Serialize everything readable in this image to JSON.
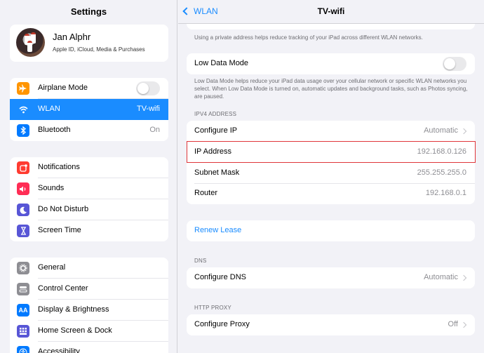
{
  "sidebar": {
    "title": "Settings",
    "profile": {
      "name": "Jan Alphr",
      "subtitle": "Apple ID, iCloud, Media & Purchases"
    },
    "group1": [
      {
        "label": "Airplane Mode",
        "icon": "airplane-icon",
        "color": "#ff9500",
        "toggle": "off"
      },
      {
        "label": "WLAN",
        "value": "TV-wifi",
        "icon": "wifi-icon",
        "color": "#1a8cff",
        "selected": true
      },
      {
        "label": "Bluetooth",
        "value": "On",
        "icon": "bluetooth-icon",
        "color": "#007aff"
      }
    ],
    "group2": [
      {
        "label": "Notifications",
        "icon": "notifications-icon",
        "color": "#ff3b30"
      },
      {
        "label": "Sounds",
        "icon": "sounds-icon",
        "color": "#ff2d55"
      },
      {
        "label": "Do Not Disturb",
        "icon": "moon-icon",
        "color": "#5856d6"
      },
      {
        "label": "Screen Time",
        "icon": "hourglass-icon",
        "color": "#5856d6"
      }
    ],
    "group3": [
      {
        "label": "General",
        "icon": "gear-icon",
        "color": "#8e8e93"
      },
      {
        "label": "Control Center",
        "icon": "control-center-icon",
        "color": "#8e8e93"
      },
      {
        "label": "Display & Brightness",
        "icon": "display-icon",
        "color": "#007aff"
      },
      {
        "label": "Home Screen & Dock",
        "icon": "home-screen-icon",
        "color": "#5856d6"
      },
      {
        "label": "Accessibility",
        "icon": "accessibility-icon",
        "color": "#007aff"
      }
    ]
  },
  "detail": {
    "back_label": "WLAN",
    "title": "TV-wifi",
    "private_note": "Using a private address helps reduce tracking of your iPad across different WLAN networks.",
    "low_data": {
      "label": "Low Data Mode",
      "toggle": "off"
    },
    "low_data_note": "Low Data Mode helps reduce your iPad data usage over your cellular network or specific WLAN networks you select. When Low Data Mode is turned on, automatic updates and background tasks, such as Photos syncing, are paused.",
    "ipv4_header": "IPV4 ADDRESS",
    "configure_ip": {
      "label": "Configure IP",
      "value": "Automatic"
    },
    "ip_address": {
      "label": "IP Address",
      "value": "192.168.0.126"
    },
    "subnet_mask": {
      "label": "Subnet Mask",
      "value": "255.255.255.0"
    },
    "router": {
      "label": "Router",
      "value": "192.168.0.1"
    },
    "renew_lease": "Renew Lease",
    "dns_header": "DNS",
    "configure_dns": {
      "label": "Configure DNS",
      "value": "Automatic"
    },
    "proxy_header": "HTTP PROXY",
    "configure_proxy": {
      "label": "Configure Proxy",
      "value": "Off"
    }
  },
  "colors": {
    "accent": "#1a8cff",
    "highlight": "#e0363a"
  }
}
